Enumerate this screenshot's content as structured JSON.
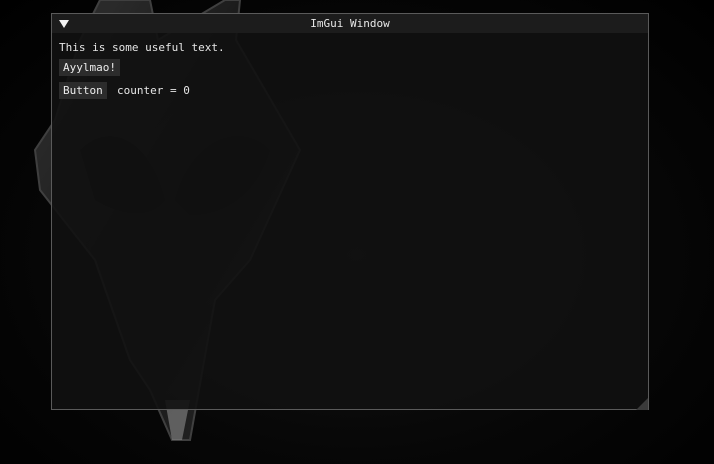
{
  "window": {
    "title": "ImGui Window"
  },
  "content": {
    "text": "This is some useful text.",
    "ayy_button_label": "Ayylmao!",
    "button_label": "Button",
    "counter_text": "counter = 0"
  },
  "icons": {
    "collapse": "triangle-down-icon",
    "resize": "resize-grip-icon",
    "background": "dragon-emblem"
  },
  "colors": {
    "window_bg": "#111111",
    "border": "#5a5a5a",
    "button_bg": "#2c2c2c",
    "text": "#e6e6e6"
  }
}
